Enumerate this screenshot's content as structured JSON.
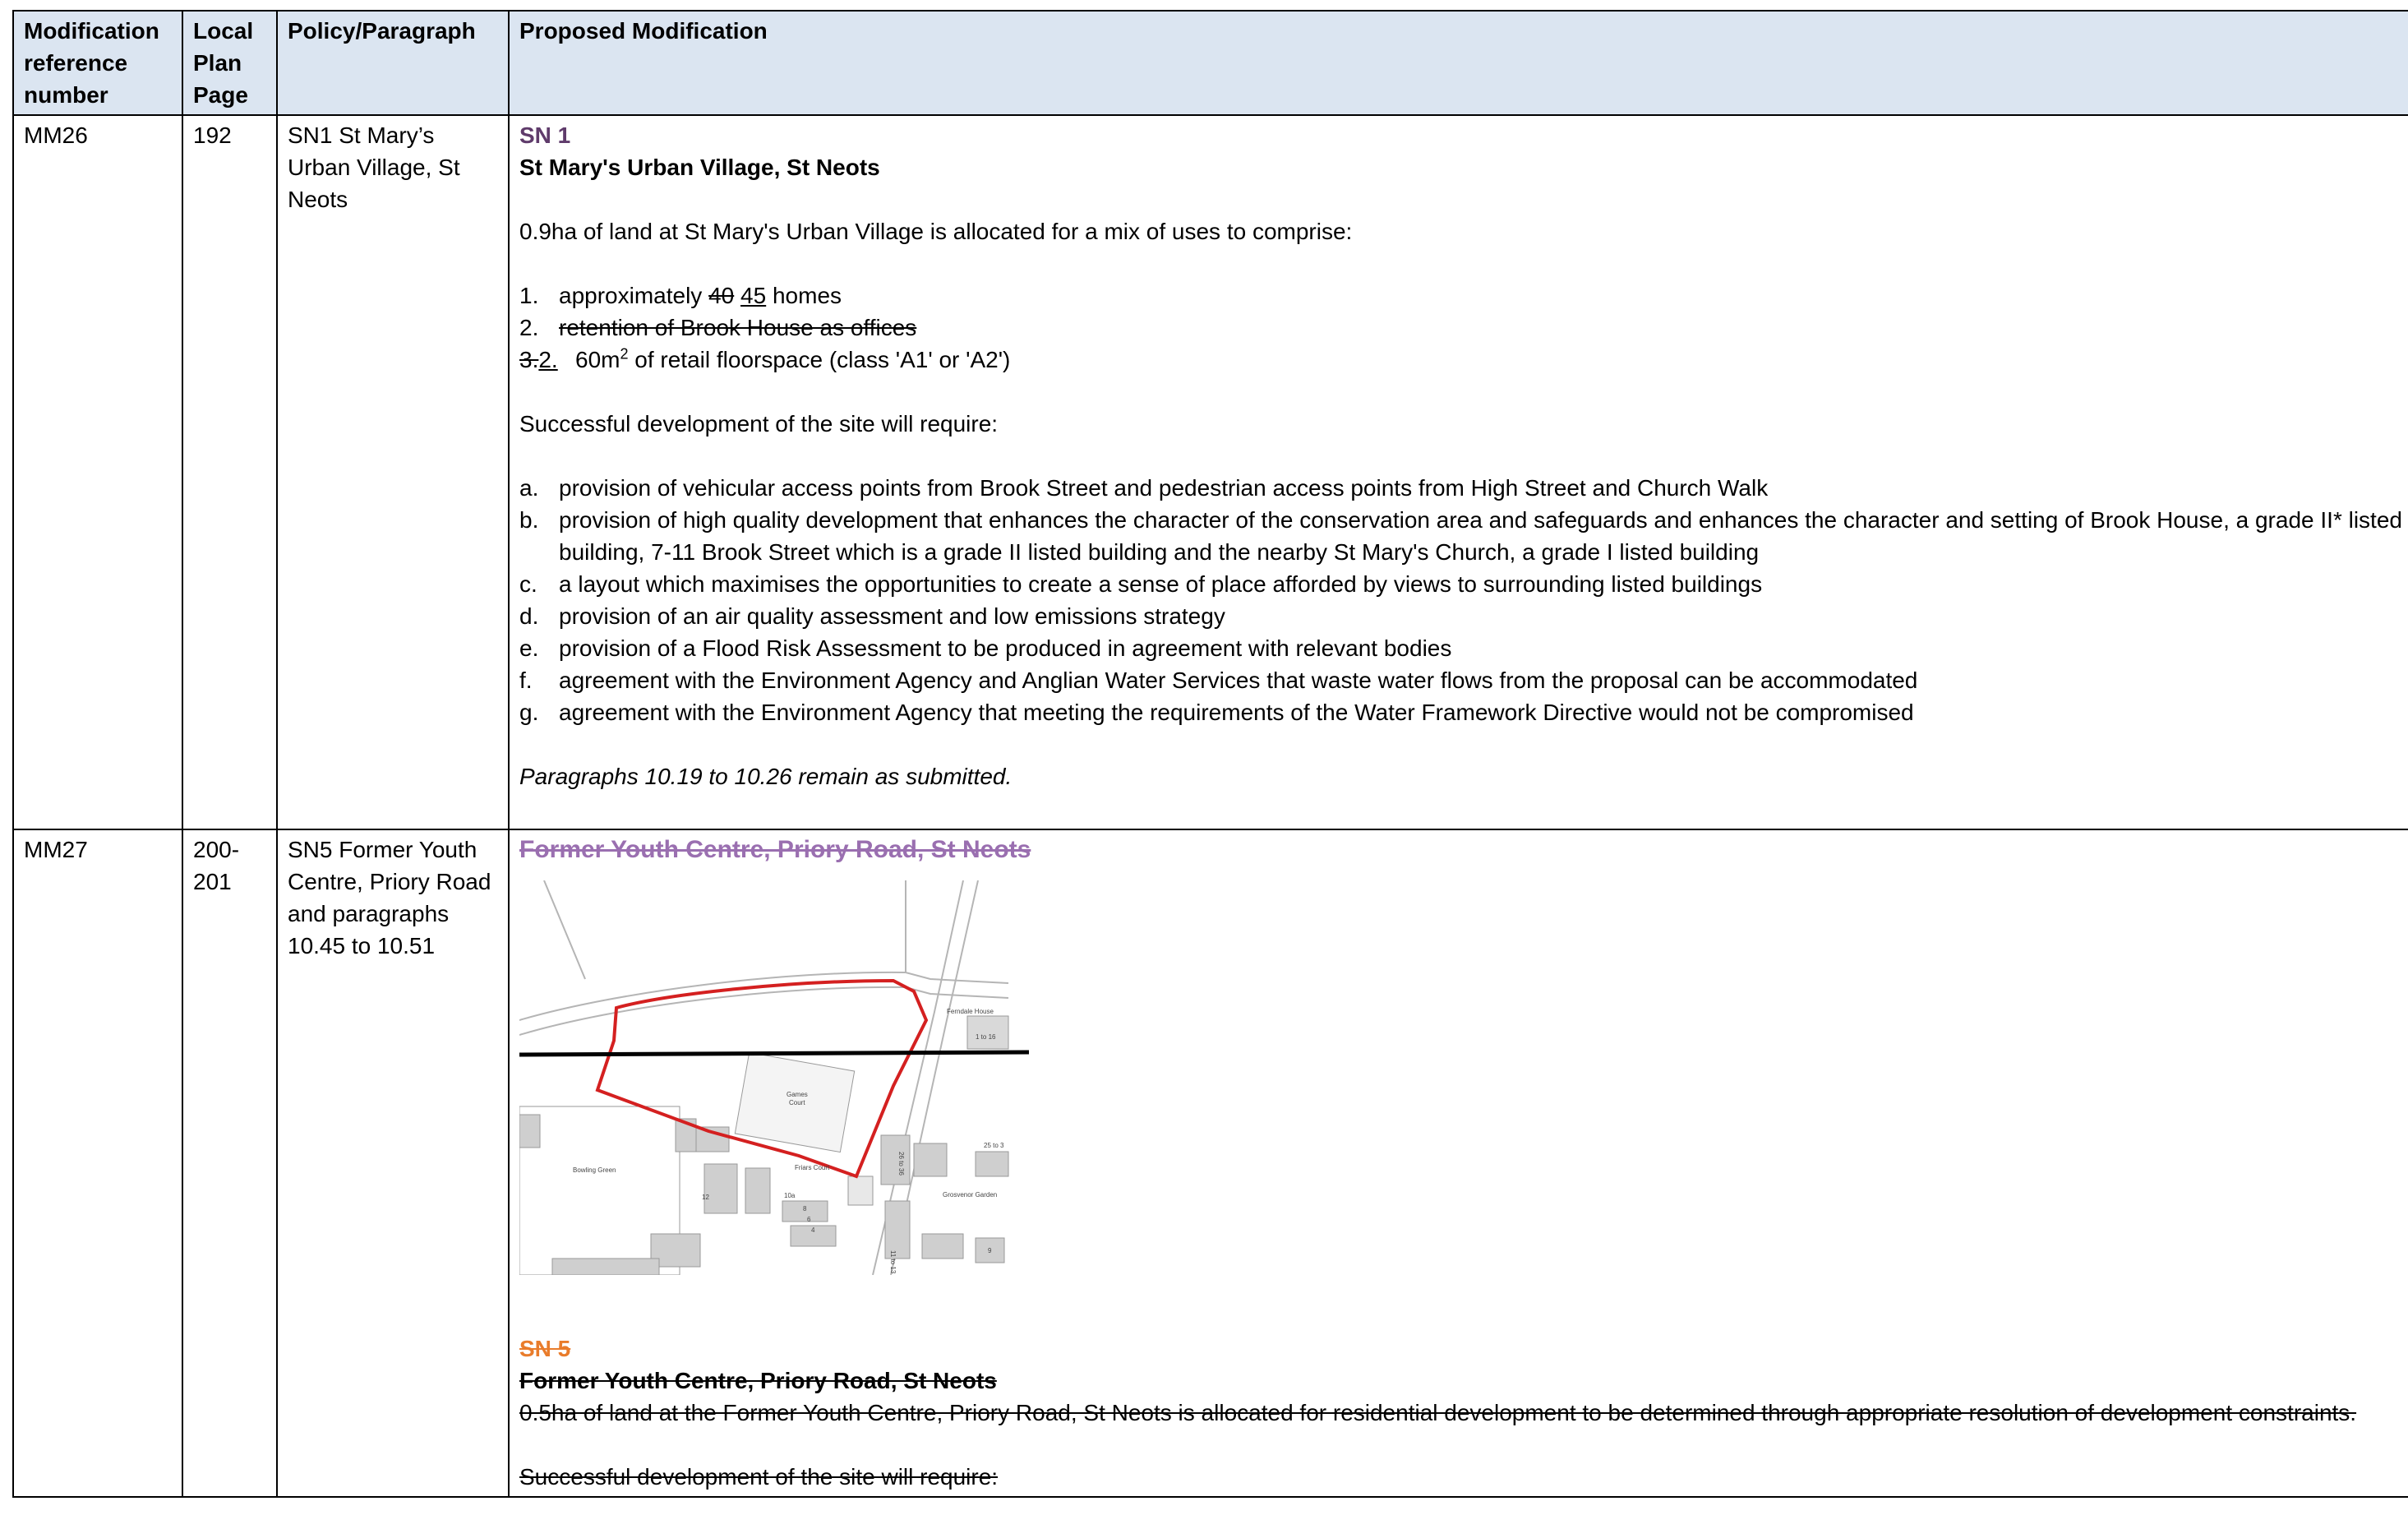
{
  "header": {
    "col1": "Modification reference number",
    "col2": "Local Plan Page",
    "col3": "Policy/Paragraph",
    "col4": "Proposed Modification"
  },
  "rows": [
    {
      "ref": "MM26",
      "page": "192",
      "policy": "SN1 St Mary’s Urban Village, St Neots",
      "heading_code": "SN 1",
      "heading_title": "St Mary's Urban Village, St Neots",
      "intro": "0.9ha of land at St Mary's Urban Village is allocated for a mix of uses to comprise:",
      "uses": {
        "item1_marker": "1.",
        "item1_prefix": "approximately",
        "item1_deleted": "40",
        "item1_inserted": "45",
        "item1_suffix": "homes",
        "item2_marker": "2.",
        "item2_text": "retention of Brook House as offices",
        "item3_marker_deleted": "3.",
        "item3_marker_inserted": "2.",
        "item3_value": "60m",
        "item3_sup": "2",
        "item3_text": "of retail floorspace (class 'A1' or 'A2')"
      },
      "require_intro": "Successful development of the site will require:",
      "requirements": [
        {
          "marker": "a.",
          "text": "provision of vehicular access points from Brook Street and pedestrian access points from High Street and Church Walk"
        },
        {
          "marker": "b.",
          "text": "provision of high quality development that enhances the character of the conservation area and safeguards and enhances the character and setting of Brook House, a grade II* listed building, 7-11 Brook Street which is a grade II listed building and the nearby St Mary's Church, a grade I listed building"
        },
        {
          "marker": "c.",
          "text": "a layout which maximises the opportunities to create a sense of place afforded by views to surrounding listed buildings"
        },
        {
          "marker": "d.",
          "text": "provision of an air quality assessment and low emissions strategy"
        },
        {
          "marker": "e.",
          "text": "provision of a Flood Risk Assessment to be produced in agreement with relevant bodies"
        },
        {
          "marker": "f.",
          "text": "agreement with the Environment Agency and Anglian Water Services that waste water flows from the proposal can be accommodated"
        },
        {
          "marker": "g.",
          "text": "agreement with the Environment Agency that meeting the requirements of the Water Framework Directive would not be compromised"
        }
      ],
      "closing": "Paragraphs 10.19 to 10.26 remain as submitted."
    },
    {
      "ref": "MM27",
      "page": "200-201",
      "policy": "SN5 Former Youth Centre, Priory Road and paragraphs 10.45 to 10.51",
      "map_title": "Former Youth Centre, Priory Road, St Neots",
      "map_labels": {
        "ferndale": "Ferndale House",
        "units": "1 to 16",
        "games1": "Games",
        "games2": "Court",
        "bowling": "Bowling Green",
        "friars": "Friars Court",
        "grosvenor": "Grosvenor Garden",
        "n25": "25 to 3",
        "n12": "12",
        "n10a": "10a",
        "n8": "8",
        "n6": "6",
        "n4": "4",
        "n9": "9",
        "n11": "11 to 13",
        "n26": "26 to 36"
      },
      "heading_code": "SN 5",
      "heading_title": "Former Youth Centre, Priory Road, St Neots",
      "intro": "0.5ha of land at the Former Youth Centre, Priory Road, St Neots is allocated for residential development to be determined through appropriate resolution of development constraints.",
      "require_intro": "Successful development of the site will require:"
    }
  ],
  "colors": {
    "header_bg": "#dbe5f1",
    "heading_purple": "#5f3b6b",
    "heading_orange": "#e97c2b",
    "site_boundary": "#d42020"
  }
}
